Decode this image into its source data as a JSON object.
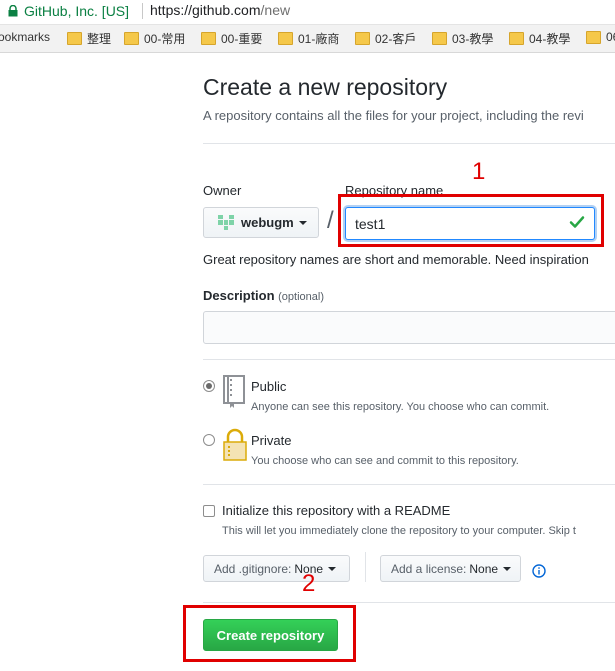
{
  "browser": {
    "site_name": "GitHub, Inc. [US]",
    "url_host": "https://github.com",
    "url_path": "/new"
  },
  "bookmarks": [
    {
      "label": "ookmarks",
      "icon": "none"
    },
    {
      "label": "整理",
      "icon": "folder-icon"
    },
    {
      "label": "00-常用",
      "icon": "folder-icon"
    },
    {
      "label": "00-重要",
      "icon": "folder-icon"
    },
    {
      "label": "01-廠商",
      "icon": "folder-icon"
    },
    {
      "label": "02-客戶",
      "icon": "folder-icon"
    },
    {
      "label": "03-教學",
      "icon": "folder-icon"
    },
    {
      "label": "04-教學",
      "icon": "folder-icon"
    },
    {
      "label": "06",
      "icon": "folder-icon"
    }
  ],
  "page": {
    "title": "Create a new repository",
    "subtitle": "A repository contains all the files for your project, including the revi"
  },
  "form": {
    "owner_label": "Owner",
    "owner_name": "webugm",
    "separator": "/",
    "repo_name_label": "Repository name",
    "repo_name_value": "test1",
    "name_hint": "Great repository names are short and memorable. Need inspiration",
    "description_label": "Description",
    "description_optional": "(optional)",
    "description_value": "",
    "visibility": {
      "public_title": "Public",
      "public_desc": "Anyone can see this repository. You choose who can commit.",
      "private_title": "Private",
      "private_desc": "You choose who can see and commit to this repository.",
      "selected": "public"
    },
    "readme_title": "Initialize this repository with a README",
    "readme_desc": "This will let you immediately clone the repository to your computer. Skip t",
    "readme_checked": false,
    "gitignore_prefix": "Add .gitignore:",
    "gitignore_value": "None",
    "license_prefix": "Add a license:",
    "license_value": "None",
    "create_label": "Create repository"
  },
  "annotations": {
    "step1": "1",
    "step2": "2",
    "color": "#e00000"
  },
  "colors": {
    "primary_green": "#28a745",
    "link_blue": "#0366d6",
    "secure_green": "#0b8043"
  }
}
